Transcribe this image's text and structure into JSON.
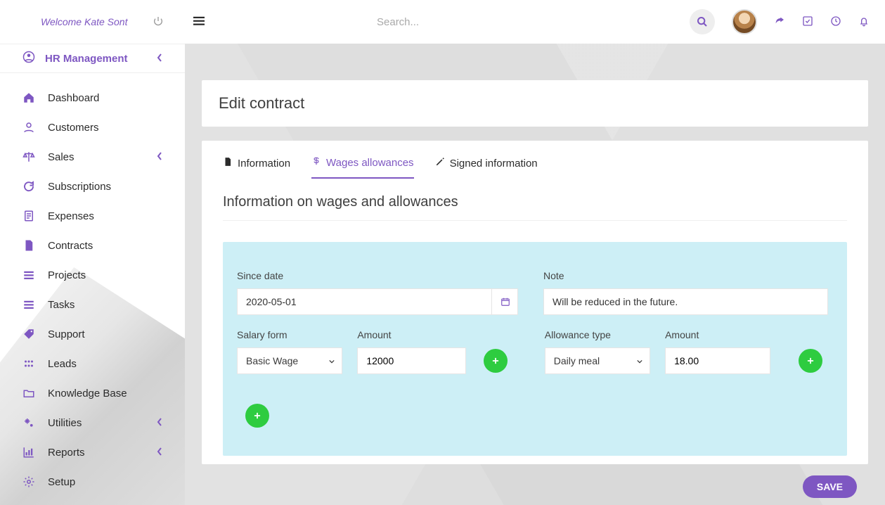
{
  "sidebar": {
    "welcome": "Welcome Kate Sont",
    "section": "HR Management",
    "items": [
      {
        "icon": "home",
        "label": "Dashboard",
        "expand": false
      },
      {
        "icon": "user",
        "label": "Customers",
        "expand": false
      },
      {
        "icon": "scales",
        "label": "Sales",
        "expand": true
      },
      {
        "icon": "refresh",
        "label": "Subscriptions",
        "expand": false
      },
      {
        "icon": "doc",
        "label": "Expenses",
        "expand": false
      },
      {
        "icon": "file",
        "label": "Contracts",
        "expand": false
      },
      {
        "icon": "bars",
        "label": "Projects",
        "expand": false
      },
      {
        "icon": "bars",
        "label": "Tasks",
        "expand": false
      },
      {
        "icon": "tag",
        "label": "Support",
        "expand": false
      },
      {
        "icon": "dots",
        "label": "Leads",
        "expand": false
      },
      {
        "icon": "folder",
        "label": "Knowledge Base",
        "expand": false
      },
      {
        "icon": "gears",
        "label": "Utilities",
        "expand": true
      },
      {
        "icon": "chart",
        "label": "Reports",
        "expand": true
      },
      {
        "icon": "gear",
        "label": "Setup",
        "expand": false
      }
    ]
  },
  "topbar": {
    "search_placeholder": "Search..."
  },
  "page": {
    "title": "Edit contract",
    "tabs": {
      "info": "Information",
      "wages": "Wages allowances",
      "signed": "Signed information"
    },
    "section_heading": "Information on wages and allowances",
    "fields": {
      "since_label": "Since date",
      "since_value": "2020-05-01",
      "note_label": "Note",
      "note_value": "Will be reduced in the future.",
      "salary_form_label": "Salary form",
      "salary_form_value": "Basic Wage",
      "salary_amount_label": "Amount",
      "salary_amount_value": "12000",
      "allowance_type_label": "Allowance type",
      "allowance_type_value": "Daily meal",
      "allowance_amount_label": "Amount",
      "allowance_amount_value": "18.00"
    },
    "save_button": "SAVE"
  }
}
